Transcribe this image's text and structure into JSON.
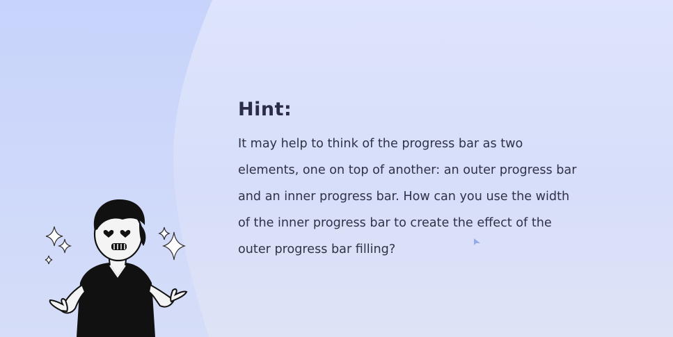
{
  "hint": {
    "title": "Hint:",
    "body": "It may help to think of the progress bar as two elements, one on top of another: an outer progress bar and an inner progress bar. How can you use the width of the inner progress bar to create the effect of the outer progress bar filling?"
  },
  "colors": {
    "background": "#d9e0fa",
    "left_panel": "#cdd8fb",
    "text": "#2f3247"
  },
  "icons": {
    "character": "shrugging-person-icon",
    "sparkle": "sparkle-icon",
    "cursor": "mouse-cursor-icon"
  }
}
